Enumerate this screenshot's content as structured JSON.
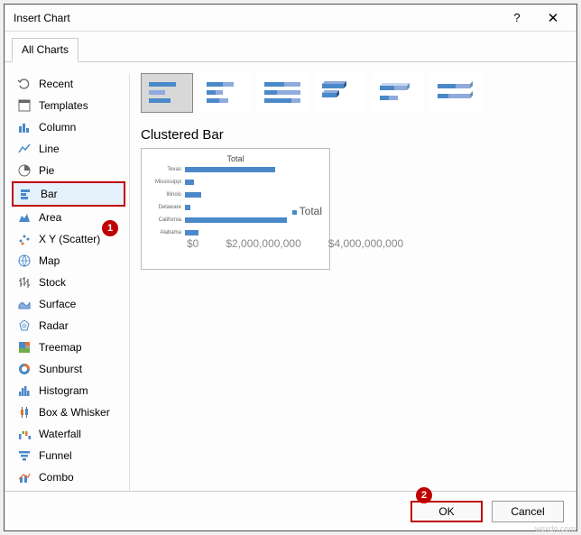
{
  "titlebar": {
    "title": "Insert Chart",
    "help": "?",
    "close": "✕"
  },
  "tabs": {
    "all": "All Charts"
  },
  "categories": [
    {
      "id": "recent",
      "label": "Recent"
    },
    {
      "id": "templates",
      "label": "Templates"
    },
    {
      "id": "column",
      "label": "Column"
    },
    {
      "id": "line",
      "label": "Line"
    },
    {
      "id": "pie",
      "label": "Pie"
    },
    {
      "id": "bar",
      "label": "Bar",
      "selected": true
    },
    {
      "id": "area",
      "label": "Area"
    },
    {
      "id": "scatter",
      "label": "X Y (Scatter)"
    },
    {
      "id": "map",
      "label": "Map"
    },
    {
      "id": "stock",
      "label": "Stock"
    },
    {
      "id": "surface",
      "label": "Surface"
    },
    {
      "id": "radar",
      "label": "Radar"
    },
    {
      "id": "treemap",
      "label": "Treemap"
    },
    {
      "id": "sunburst",
      "label": "Sunburst"
    },
    {
      "id": "histogram",
      "label": "Histogram"
    },
    {
      "id": "boxwhisker",
      "label": "Box & Whisker"
    },
    {
      "id": "waterfall",
      "label": "Waterfall"
    },
    {
      "id": "funnel",
      "label": "Funnel"
    },
    {
      "id": "combo",
      "label": "Combo"
    }
  ],
  "markers": {
    "one": "1",
    "two": "2"
  },
  "subtype_name": "Clustered Bar",
  "subtypes": [
    "clustered-bar",
    "stacked-bar",
    "100-stacked-bar",
    "3d-clustered-bar",
    "3d-stacked-bar",
    "3d-100-stacked-bar"
  ],
  "preview": {
    "title": "Total",
    "legend": "Total",
    "axis_ticks": [
      "$0",
      "$2,000,000,000",
      "$4,000,000,000"
    ]
  },
  "chart_data": {
    "type": "bar",
    "orientation": "horizontal",
    "title": "Total",
    "xlabel": "",
    "ylabel": "",
    "xlim": [
      0,
      5000000000
    ],
    "categories": [
      "Texas",
      "Mississippi",
      "Illinois",
      "Delaware",
      "California",
      "Alabama"
    ],
    "series": [
      {
        "name": "Total",
        "values": [
          4000000000,
          400000000,
          700000000,
          250000000,
          4500000000,
          600000000
        ]
      }
    ]
  },
  "footer": {
    "ok": "OK",
    "cancel": "Cancel"
  },
  "watermark": "wsxdn.com"
}
